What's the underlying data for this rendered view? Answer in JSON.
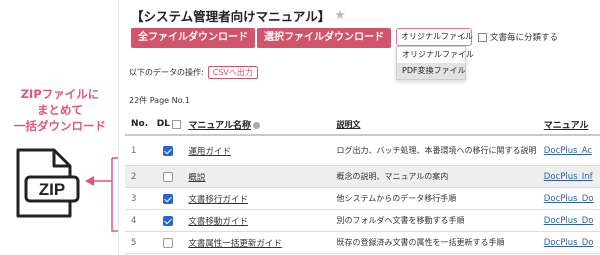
{
  "annotation": {
    "lines": [
      "ZIPファイルに",
      "まとめて",
      "一括ダウンロード"
    ],
    "zip_label": "ZIP",
    "accent_color": "#e05577"
  },
  "page": {
    "title": "【システム管理者向けマニュアル】",
    "star_icon": "star-icon"
  },
  "toolbar": {
    "download_all_label": "全ファイルダウンロード",
    "download_selected_label": "選択ファイルダウンロード",
    "button_color": "#d2546a",
    "file_type_select": {
      "selected": "オリジナルファイル",
      "options": [
        "オリジナルファイル",
        "PDF変換ファイル"
      ],
      "highlighted": "PDF変換ファイル"
    },
    "split_checkbox_label": "文書毎に分類する"
  },
  "operations": {
    "label": "以下のデータの操作:",
    "csv_label": "CSVへ出力"
  },
  "list_info": {
    "count_text": "22件 Page No.1"
  },
  "table": {
    "headers": {
      "no": "No.",
      "dl": "DL",
      "name": "マニュアル名称",
      "description": "説明文",
      "manual": "マニュアル"
    },
    "rows": [
      {
        "no": "1",
        "checked": true,
        "name": "運用ガイド",
        "description": "ログ出力、バッチ処理、本番環境への移行に関する説明",
        "manual": "DocPlus_Ac"
      },
      {
        "no": "2",
        "checked": false,
        "name": "概説",
        "description": "概念の説明、マニュアルの案内",
        "manual": "DocPlus_Inf"
      },
      {
        "no": "3",
        "checked": true,
        "name": "文書移行ガイド",
        "description": "他システムからのデータ移行手順",
        "manual": "DocPlus_Do"
      },
      {
        "no": "4",
        "checked": true,
        "name": "文書移動ガイド",
        "description": "別のフォルダへ文書を移動する手順",
        "manual": "DocPlus_Do"
      },
      {
        "no": "5",
        "checked": false,
        "name": "文書属性一括更新ガイド",
        "description": "既存の登録済み文書の属性を一括更新する手順",
        "manual": "DocPlus_Do"
      }
    ]
  }
}
